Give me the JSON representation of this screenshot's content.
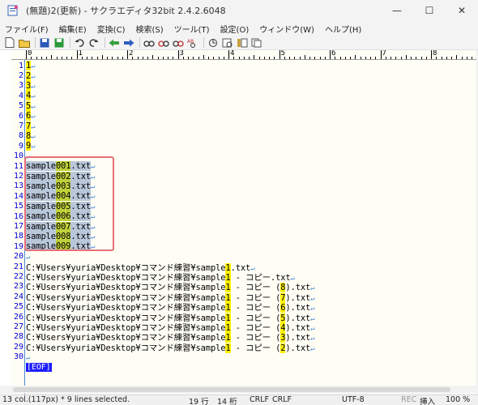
{
  "window": {
    "title": "(無題)2(更新) - サクラエディタ32bit 2.4.2.6048",
    "minimize_glyph": "—",
    "maximize_glyph": "☐",
    "close_glyph": "✕"
  },
  "menu": {
    "items": [
      "ファイル(F)",
      "編集(E)",
      "変換(C)",
      "検索(S)",
      "ツール(T)",
      "設定(O)",
      "ウィンドウ(W)",
      "ヘルプ(H)"
    ]
  },
  "toolbar": {
    "icons": [
      "new-file-icon",
      "open-folder-icon",
      "save-icon",
      "save-all-icon",
      "undo-icon",
      "redo-icon",
      "jump-back-icon",
      "jump-forward-icon",
      "search-icon",
      "search-prev-icon",
      "search-next-icon",
      "replace-icon",
      "bookmark-icon",
      "grep-icon",
      "outline-icon",
      "window-list-icon"
    ]
  },
  "ruler": {
    "labels": [
      "0",
      "1",
      "2",
      "3",
      "4",
      "5",
      "6",
      "7",
      "8",
      "9"
    ]
  },
  "editor": {
    "lines": [
      {
        "n": "1",
        "segs": [
          {
            "t": "1",
            "c": "hl"
          }
        ]
      },
      {
        "n": "2",
        "segs": [
          {
            "t": "2",
            "c": "hl"
          }
        ]
      },
      {
        "n": "3",
        "segs": [
          {
            "t": "3",
            "c": "hl"
          }
        ]
      },
      {
        "n": "4",
        "segs": [
          {
            "t": "4",
            "c": "hl"
          }
        ]
      },
      {
        "n": "5",
        "segs": [
          {
            "t": "5",
            "c": "hl"
          }
        ]
      },
      {
        "n": "6",
        "segs": [
          {
            "t": "6",
            "c": "hl"
          }
        ]
      },
      {
        "n": "7",
        "segs": [
          {
            "t": "7",
            "c": "hl"
          }
        ]
      },
      {
        "n": "8",
        "segs": [
          {
            "t": "8",
            "c": "hl"
          }
        ]
      },
      {
        "n": "9",
        "segs": [
          {
            "t": "9",
            "c": "hl"
          }
        ]
      },
      {
        "n": "10",
        "segs": []
      },
      {
        "n": "11",
        "segs": [
          {
            "t": "sample",
            "c": "sel"
          },
          {
            "t": "001",
            "c": "sel-hl"
          },
          {
            "t": ".txt",
            "c": "sel"
          }
        ]
      },
      {
        "n": "12",
        "segs": [
          {
            "t": "sample",
            "c": "sel"
          },
          {
            "t": "002",
            "c": "sel-hl"
          },
          {
            "t": ".txt",
            "c": "sel"
          }
        ]
      },
      {
        "n": "13",
        "segs": [
          {
            "t": "sample",
            "c": "sel"
          },
          {
            "t": "003",
            "c": "sel-hl"
          },
          {
            "t": ".txt",
            "c": "sel"
          }
        ]
      },
      {
        "n": "14",
        "segs": [
          {
            "t": "sample",
            "c": "sel"
          },
          {
            "t": "004",
            "c": "sel-hl"
          },
          {
            "t": ".txt",
            "c": "sel"
          }
        ]
      },
      {
        "n": "15",
        "segs": [
          {
            "t": "sample",
            "c": "sel"
          },
          {
            "t": "005",
            "c": "sel-hl"
          },
          {
            "t": ".txt",
            "c": "sel"
          }
        ]
      },
      {
        "n": "16",
        "segs": [
          {
            "t": "sample",
            "c": "sel"
          },
          {
            "t": "006",
            "c": "sel-hl"
          },
          {
            "t": ".txt",
            "c": "sel"
          }
        ]
      },
      {
        "n": "17",
        "segs": [
          {
            "t": "sample",
            "c": "sel"
          },
          {
            "t": "007",
            "c": "sel-hl"
          },
          {
            "t": ".txt",
            "c": "sel"
          }
        ]
      },
      {
        "n": "18",
        "segs": [
          {
            "t": "sample",
            "c": "sel"
          },
          {
            "t": "008",
            "c": "sel-hl"
          },
          {
            "t": ".txt",
            "c": "sel"
          }
        ]
      },
      {
        "n": "19",
        "segs": [
          {
            "t": "sample",
            "c": "sel"
          },
          {
            "t": "009",
            "c": "sel-hl"
          },
          {
            "t": ".txt",
            "c": "sel"
          }
        ]
      },
      {
        "n": "20",
        "segs": []
      },
      {
        "n": "21",
        "segs": [
          {
            "t": "C:¥Users¥yuria¥Desktop¥コマンド練習¥sample",
            "c": ""
          },
          {
            "t": "1",
            "c": "hl"
          },
          {
            "t": ".txt",
            "c": ""
          }
        ]
      },
      {
        "n": "22",
        "segs": [
          {
            "t": "C:¥Users¥yuria¥Desktop¥コマンド練習¥sample",
            "c": ""
          },
          {
            "t": "1",
            "c": "hl"
          },
          {
            "t": " - コピー.txt",
            "c": ""
          }
        ]
      },
      {
        "n": "23",
        "segs": [
          {
            "t": "C:¥Users¥yuria¥Desktop¥コマンド練習¥sample",
            "c": ""
          },
          {
            "t": "1",
            "c": "hl"
          },
          {
            "t": " - コピー (",
            "c": ""
          },
          {
            "t": "8",
            "c": "hl"
          },
          {
            "t": ").txt",
            "c": ""
          }
        ]
      },
      {
        "n": "24",
        "segs": [
          {
            "t": "C:¥Users¥yuria¥Desktop¥コマンド練習¥sample",
            "c": ""
          },
          {
            "t": "1",
            "c": "hl"
          },
          {
            "t": " - コピー (",
            "c": ""
          },
          {
            "t": "7",
            "c": "hl"
          },
          {
            "t": ").txt",
            "c": ""
          }
        ]
      },
      {
        "n": "25",
        "segs": [
          {
            "t": "C:¥Users¥yuria¥Desktop¥コマンド練習¥sample",
            "c": ""
          },
          {
            "t": "1",
            "c": "hl"
          },
          {
            "t": " - コピー (",
            "c": ""
          },
          {
            "t": "6",
            "c": "hl"
          },
          {
            "t": ").txt",
            "c": ""
          }
        ]
      },
      {
        "n": "26",
        "segs": [
          {
            "t": "C:¥Users¥yuria¥Desktop¥コマンド練習¥sample",
            "c": ""
          },
          {
            "t": "1",
            "c": "hl"
          },
          {
            "t": " - コピー (",
            "c": ""
          },
          {
            "t": "5",
            "c": "hl"
          },
          {
            "t": ").txt",
            "c": ""
          }
        ]
      },
      {
        "n": "27",
        "segs": [
          {
            "t": "C:¥Users¥yuria¥Desktop¥コマンド練習¥sample",
            "c": ""
          },
          {
            "t": "1",
            "c": "hl"
          },
          {
            "t": " - コピー (",
            "c": ""
          },
          {
            "t": "4",
            "c": "hl"
          },
          {
            "t": ").txt",
            "c": ""
          }
        ]
      },
      {
        "n": "28",
        "segs": [
          {
            "t": "C:¥Users¥yuria¥Desktop¥コマンド練習¥sample",
            "c": ""
          },
          {
            "t": "1",
            "c": "hl"
          },
          {
            "t": " - コピー (",
            "c": ""
          },
          {
            "t": "3",
            "c": "hl"
          },
          {
            "t": ").txt",
            "c": ""
          }
        ]
      },
      {
        "n": "29",
        "segs": [
          {
            "t": "C:¥Users¥yuria¥Desktop¥コマンド練習¥sample",
            "c": ""
          },
          {
            "t": "1",
            "c": "hl"
          },
          {
            "t": " - コピー (",
            "c": ""
          },
          {
            "t": "2",
            "c": "hl"
          },
          {
            "t": ").txt",
            "c": ""
          }
        ]
      },
      {
        "n": "30",
        "segs": []
      }
    ],
    "eof_label": "[EOF]",
    "eol_glyph": "↵"
  },
  "status": {
    "selection_info": "13 col.(117px) * 9 lines selected.",
    "line": "19 行",
    "column": "14 桁",
    "eol1": "CRLF",
    "eol2": "CRLF",
    "encoding": "UTF-8",
    "rec": "REC",
    "mode": "挿入",
    "zoom": "100 %"
  },
  "colors": {
    "highlight": "#fff200",
    "selection": "#b9c7da",
    "selection_box": "#e8707a",
    "line_number": "#0000d8",
    "eol_mark": "#4a88d8"
  }
}
